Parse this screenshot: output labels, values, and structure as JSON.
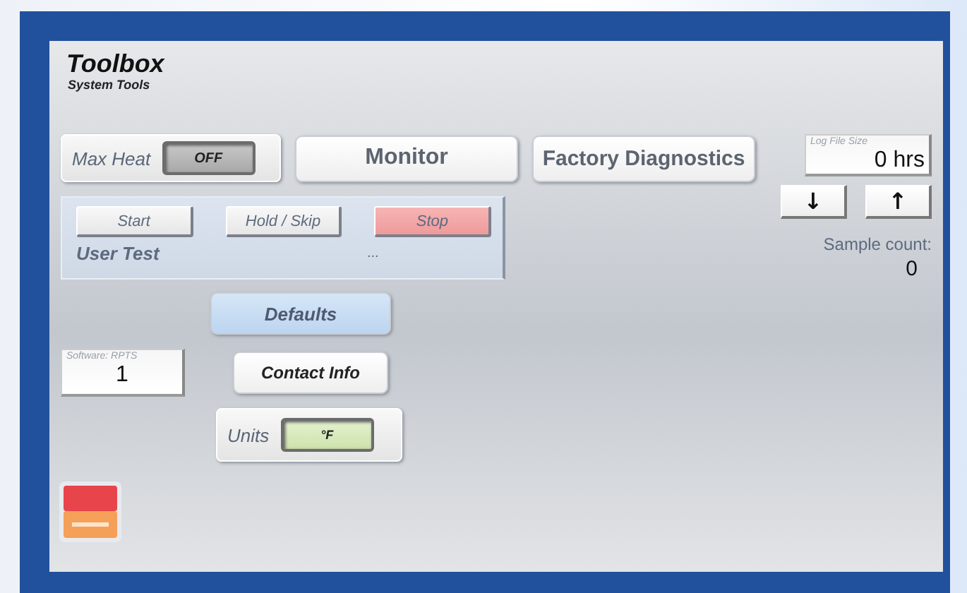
{
  "header": {
    "title": "Toolbox",
    "subtitle": "System Tools"
  },
  "max_heat": {
    "label": "Max Heat",
    "value": "OFF",
    "on": false
  },
  "nav_buttons": [
    "Monitor",
    "Factory Diagnostics"
  ],
  "log_file_size": {
    "label": "Log File Size",
    "value": "0 hrs"
  },
  "user_test": {
    "buttons": [
      {
        "label": "Start",
        "kind": "normal"
      },
      {
        "label": "Hold / Skip",
        "kind": "normal"
      },
      {
        "label": "Stop",
        "kind": "stop"
      }
    ],
    "label": "User Test",
    "status": "..."
  },
  "scroll_buttons": [
    "↓",
    "↑"
  ],
  "sample_count": {
    "label": "Sample count:",
    "value": "0"
  },
  "defaults_button": "Defaults",
  "software": {
    "label": "Software: RPTS",
    "value": "1"
  },
  "contact_button": "Contact Info",
  "units": {
    "label": "Units",
    "value": "°F"
  }
}
